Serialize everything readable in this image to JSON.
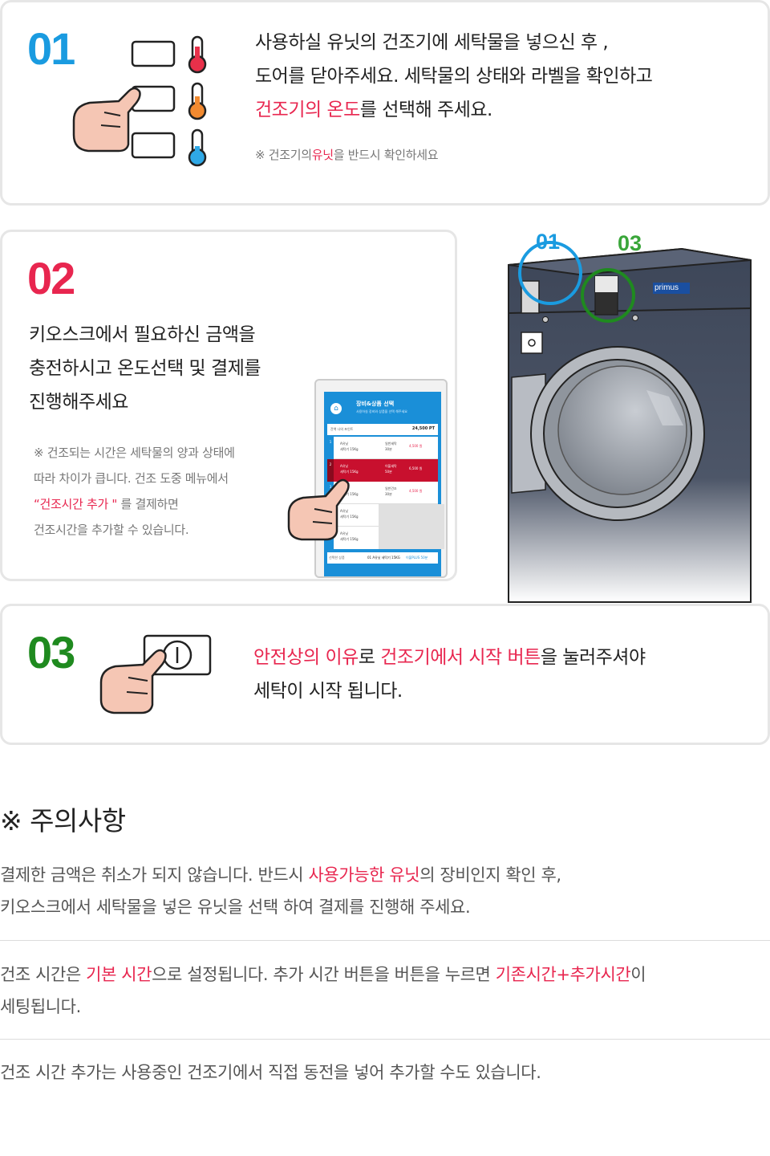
{
  "step1": {
    "number": "01",
    "line1": "사용하실 유닛의 건조기에 세탁물을 넣으신 후 ,",
    "line2": "도어를 닫아주세요. 세탁물의 상태와 라벨을 확인하고",
    "line3_highlight": "건조기의 온도",
    "line3_rest": "를 선택해 주세요.",
    "note_prefix": "※ 건조기의",
    "note_highlight": "유닛",
    "note_suffix": "을 반드시 확인하세요"
  },
  "step2": {
    "number": "02",
    "line1": "키오스크에서 필요하신 금액을",
    "line2": "충전하시고 온도선택 및 결제를",
    "line3": "진행해주세요",
    "note1": "※ 건조되는 시간은 세탁물의 양과 상태에",
    "note2": "따라 차이가 큽니다. 건조 도중 메뉴에서",
    "note3_highlight": "“건조시간 추가 \"",
    "note3_rest": " 를 결제하면",
    "note4": "건조시간을 추가할 수 있습니다.",
    "kiosk": {
      "title": "장비&상품 선택",
      "subtitle": "사용하실 장비와 상품을 선택 해주세요",
      "balance_label": "잔액 나의 포인트",
      "balance_value": "24,500 PT",
      "rows": [
        {
          "no": "1",
          "unit": "A유닛",
          "name": "세탁기 15Kg",
          "opt": "일반세탁",
          "time": "30분",
          "price": "4,500 원"
        },
        {
          "no": "2",
          "unit": "A유닛",
          "name": "세탁기 15Kg",
          "opt": "이불세탁",
          "time": "50분",
          "price": "6,500 원"
        },
        {
          "no": "3",
          "unit": "A유닛",
          "name": "세탁기 15Kg",
          "opt": "일반건조",
          "time": "30분",
          "price": "4,500 원"
        },
        {
          "no": "4",
          "unit": "A유닛",
          "name": "세탁기 15Kg",
          "opt": "",
          "time": "",
          "price": ""
        },
        {
          "no": "5",
          "unit": "A유닛",
          "name": "세탁기 15Kg",
          "opt": "",
          "time": "",
          "price": ""
        }
      ],
      "footer_label": "선택한 상품",
      "footer_value": "01 A유닛 세탁기 15KG",
      "footer_accent": "이불PLUS 50분"
    }
  },
  "machine": {
    "label01": "01",
    "label03": "03",
    "brand": "primus"
  },
  "step3": {
    "number": "03",
    "line1_h1": "안전상의 이유",
    "line1_t1": "로 ",
    "line1_h2": "건조기에서 시작 버튼",
    "line1_t2": "을 눌러주셔야",
    "line2": "세탁이 시작 됩니다."
  },
  "caution": {
    "title": "※ 주의사항",
    "item1_a": "결제한 금액은 취소가 되지 않습니다. 반드시 ",
    "item1_h": "사용가능한 유닛",
    "item1_b": "의 장비인지 확인 후,",
    "item1_line2": "키오스크에서 세탁물을 넣은 유닛을 선택 하여 결제를 진행해 주세요.",
    "item2_a": "건조 시간은 ",
    "item2_h1": "기본 시간",
    "item2_b": "으로 설정됩니다. 추가 시간 버튼을 버튼을 누르면 ",
    "item2_h2": "기존시간+추가시간",
    "item2_c": "이",
    "item2_line2": "세팅됩니다.",
    "item3": "건조 시간 추가는 사용중인 건조기에서 직접 동전을 넣어 추가할 수도 있습니다."
  },
  "colors": {
    "blue": "#1a9be0",
    "red": "#e8264f",
    "green": "#1f8a1f",
    "machine": "#3d4658"
  },
  "icons": [
    "thermometer-hot-icon",
    "thermometer-warm-icon",
    "thermometer-cold-icon",
    "hand-pointer-icon",
    "power-button-icon",
    "home-icon"
  ]
}
